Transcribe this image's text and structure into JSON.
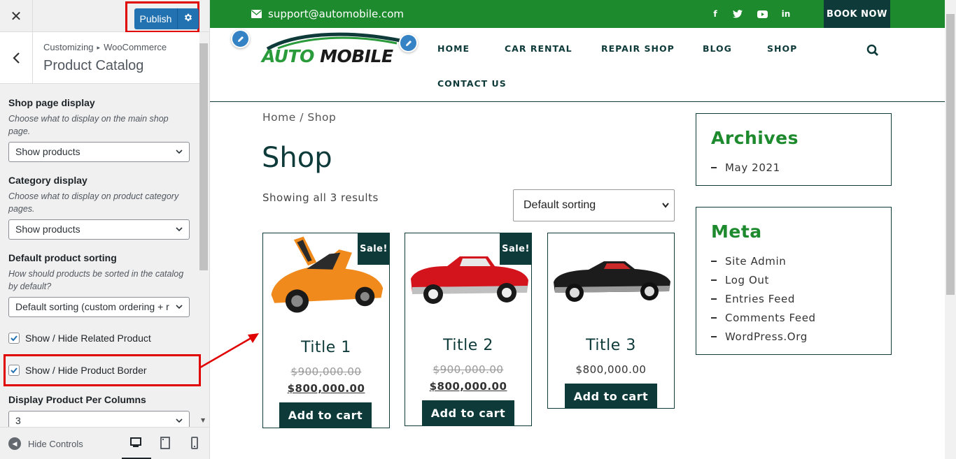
{
  "customizer": {
    "close_glyph": "✕",
    "publish_label": "Publish",
    "breadcrumb_root": "Customizing",
    "breadcrumb_section": "WooCommerce",
    "panel_title": "Product Catalog",
    "shop_display": {
      "title": "Shop page display",
      "desc": "Choose what to display on the main shop page.",
      "value": "Show products"
    },
    "category_display": {
      "title": "Category display",
      "desc": "Choose what to display on product category pages.",
      "value": "Show products"
    },
    "default_sorting": {
      "title": "Default product sorting",
      "desc": "How should products be sorted in the catalog by default?",
      "value": "Default sorting (custom ordering + r"
    },
    "related_product": {
      "label": "Show / Hide Related Product",
      "checked": true
    },
    "product_border": {
      "label": "Show / Hide Product Border",
      "checked": true
    },
    "per_columns": {
      "title": "Display Product Per Columns",
      "value": "3"
    },
    "hide_controls_label": "Hide Controls"
  },
  "site": {
    "email": "support@automobile.com",
    "social": [
      "f",
      "t",
      "y",
      "in"
    ],
    "book_now": "BOOK NOW",
    "logo_auto": "AUTO",
    "logo_mobile": "MOBILE",
    "nav": [
      "HOME",
      "CAR RENTAL",
      "REPAIR SHOP",
      "BLOG",
      "SHOP",
      "CONTACT US"
    ],
    "breadcrumb": "Home / Shop",
    "page_title": "Shop",
    "result_count": "Showing all 3 results",
    "sort_value": "Default sorting",
    "products": [
      {
        "title": "Title 1",
        "sale": "Sale!",
        "old_price": "$900,000.00",
        "price": "$800,000.00",
        "button": "Add to cart",
        "car_color": "#f08a1c"
      },
      {
        "title": "Title 2",
        "sale": "Sale!",
        "old_price": "$900,000.00",
        "price": "$800,000.00",
        "button": "Add to cart",
        "car_color": "#d3141c"
      },
      {
        "title": "Title 3",
        "sale": "",
        "old_price": "",
        "price": "$800,000.00",
        "button": "Add to cart",
        "car_color": "#1c1c1c"
      }
    ],
    "archives": {
      "title": "Archives",
      "items": [
        "May 2021"
      ]
    },
    "meta": {
      "title": "Meta",
      "items": [
        "Site Admin",
        "Log Out",
        "Entries Feed",
        "Comments Feed",
        "WordPress.Org"
      ]
    }
  },
  "colors": {
    "brand_green": "#1e8a2e",
    "dark_teal": "#0e3b3a",
    "wp_blue": "#2271b1",
    "highlight_red": "#e00000"
  }
}
